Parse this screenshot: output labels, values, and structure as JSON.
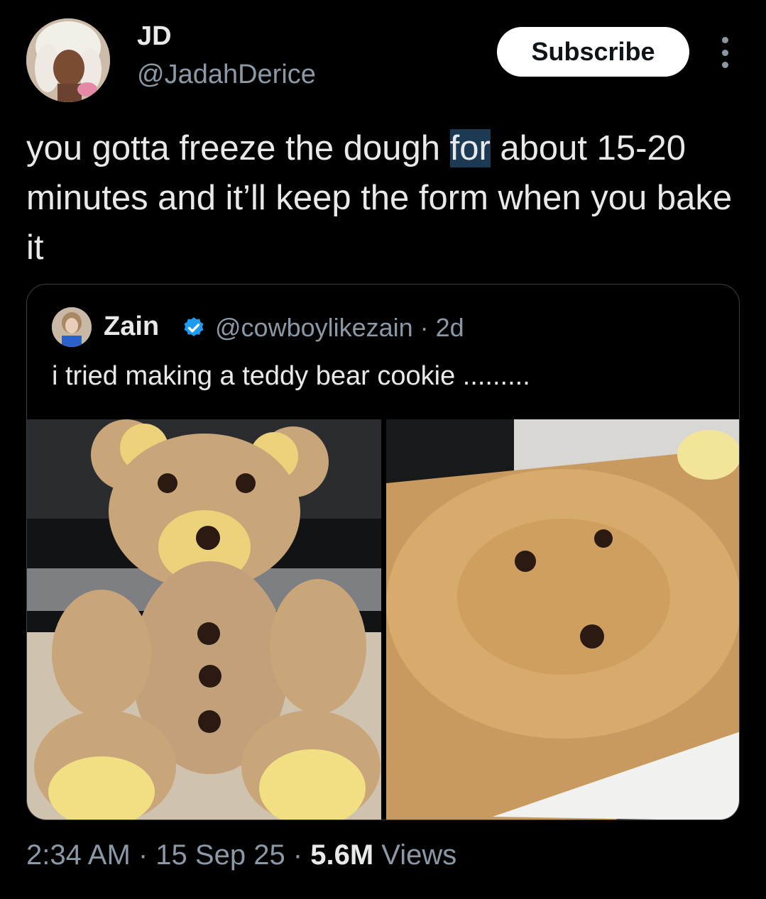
{
  "author": {
    "name": "JD",
    "handle": "@JadahDerice"
  },
  "subscribe_label": "Subscribe",
  "tweet": {
    "text_before": "you gotta freeze the dough ",
    "text_highlight": "for",
    "text_after": " about 15-20 minutes and it’ll keep the form when you bake it"
  },
  "quote": {
    "name": "Zain",
    "handle_time": "@cowboylikezain · 2d",
    "text": "i tried making a teddy bear cookie .........",
    "verified_color": "#1d9bf0"
  },
  "meta": {
    "time_date": "2:34 AM · 15 Sep 25 · ",
    "views_count": "5.6M",
    "views_label": " Views"
  },
  "icons": [
    "more-options-icon",
    "verified-badge-icon"
  ]
}
